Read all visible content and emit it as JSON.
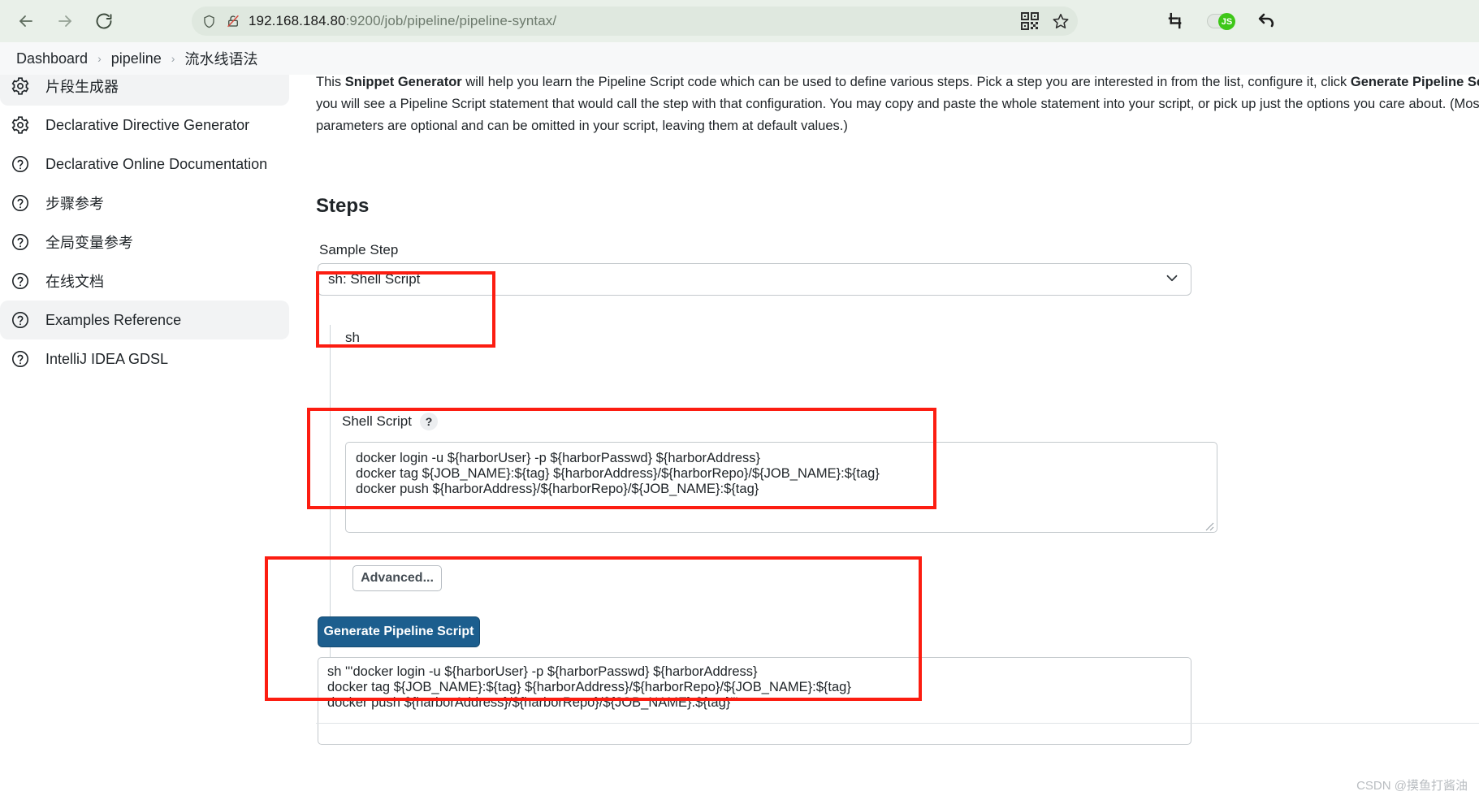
{
  "browser": {
    "back_icon": "back-arrow-icon",
    "forward_icon": "forward-arrow-icon",
    "reload_icon": "reload-icon",
    "shield_icon": "shield-icon",
    "insecure_icon": "insecure-lock-icon",
    "url_host": "192.168.184.80",
    "url_rest": ":9200/job/pipeline/pipeline-syntax/",
    "url_full": "192.168.184.80:9200/job/pipeline/pipeline-syntax/",
    "qr_icon": "qr-code-icon",
    "bookmark_icon": "star-bookmark-icon",
    "crop_icon": "crop-capture-icon",
    "js_toggle_label": "JS",
    "undo_icon": "undo-arrow-icon"
  },
  "breadcrumb": {
    "items": [
      {
        "label": "Dashboard"
      },
      {
        "label": "pipeline"
      },
      {
        "label": "流水线语法"
      }
    ],
    "separator": "›"
  },
  "sidebar": {
    "items": [
      {
        "label": "片段生成器",
        "icon": "gear-icon",
        "active": true
      },
      {
        "label": "Declarative Directive Generator",
        "icon": "gear-icon",
        "active": false
      },
      {
        "label": "Declarative Online Documentation",
        "icon": "help-circle-icon",
        "active": false
      },
      {
        "label": "步骤参考",
        "icon": "help-circle-icon",
        "active": false
      },
      {
        "label": "全局变量参考",
        "icon": "help-circle-icon",
        "active": false
      },
      {
        "label": "在线文档",
        "icon": "help-circle-icon",
        "active": false
      },
      {
        "label": "Examples Reference",
        "icon": "help-circle-icon",
        "active": true
      },
      {
        "label": "IntelliJ IDEA GDSL",
        "icon": "help-circle-icon",
        "active": false
      }
    ]
  },
  "main": {
    "intro": {
      "prefix": "This ",
      "bold1": "Snippet Generator",
      "mid1": " will help you learn the Pipeline Script code which can be used to define various steps. Pick a step you are interested in from the list, configure it, click ",
      "bold2": "Generate Pipeline Script",
      "mid2": ", and you will see a Pipeline Script statement that would call the step with that configuration. You may copy and paste the whole statement into your script, or pick up just the options you care about. (Most parameters are optional and can be omitted in your script, leaving them at default values.)"
    },
    "steps_heading": "Steps",
    "sample_step_label": "Sample Step",
    "sample_step_value": "sh: Shell Script",
    "sample_step_chevron": "chevron-down-icon",
    "sh_marker": "sh",
    "shell_script_label": "Shell Script",
    "help_badge": "?",
    "shell_script_value": "docker login -u ${harborUser} -p ${harborPasswd} ${harborAddress}\ndocker tag ${JOB_NAME}:${tag} ${harborAddress}/${harborRepo}/${JOB_NAME}:${tag}\ndocker push ${harborAddress}/${harborRepo}/${JOB_NAME}:${tag}",
    "advanced_label": "Advanced...",
    "generate_label": "Generate Pipeline Script",
    "generated_output": "sh '''docker login -u ${harborUser} -p ${harborPasswd} ${harborAddress}\ndocker tag ${JOB_NAME}:${tag} ${harborAddress}/${harborRepo}/${JOB_NAME}:${tag}\ndocker push ${harborAddress}/${harborRepo}/${JOB_NAME}:${tag}'''"
  },
  "annotations": {
    "color": "#fc1d11",
    "boxes": [
      {
        "target": "sample-step-field"
      },
      {
        "target": "shell-script-field"
      },
      {
        "target": "generate-and-output"
      }
    ]
  },
  "watermark": {
    "text": "CSDN @摸鱼打酱油"
  }
}
